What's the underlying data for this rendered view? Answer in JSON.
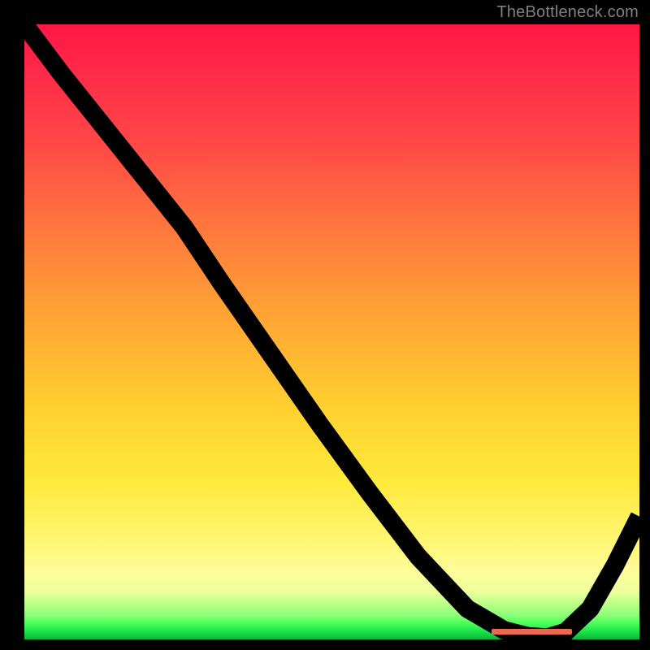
{
  "meta": {
    "watermark": "TheBottleneck.com"
  },
  "palette": {
    "top": "#ff1744",
    "mid": "#ffcf30",
    "bottom": "#0fb43a",
    "marker": "#e86a55",
    "curve": "#000000"
  },
  "chart_data": {
    "type": "line",
    "title": "",
    "xlabel": "",
    "ylabel": "",
    "xlim": [
      0,
      100
    ],
    "ylim": [
      0,
      100
    ],
    "annotations": [
      "TheBottleneck.com"
    ],
    "heat_background": {
      "direction": "vertical",
      "stops": [
        {
          "pos": 0,
          "color": "#ff1744"
        },
        {
          "pos": 34,
          "color": "#ff7a3d"
        },
        {
          "pos": 62,
          "color": "#ffcf30"
        },
        {
          "pos": 89,
          "color": "#fffc9a"
        },
        {
          "pos": 97.4,
          "color": "#4cff5a"
        },
        {
          "pos": 100,
          "color": "#0fb43a"
        }
      ]
    },
    "series": [
      {
        "name": "bottleneck_curve",
        "x": [
          0,
          6,
          12,
          18,
          22,
          26,
          32,
          40,
          48,
          56,
          64,
          72,
          78,
          82,
          85,
          88,
          92,
          96,
          100
        ],
        "y": [
          100,
          92,
          84.5,
          77,
          72,
          67,
          58,
          46.5,
          35,
          24,
          13.5,
          5,
          1.5,
          0.5,
          0.3,
          1.2,
          5,
          12,
          20
        ]
      }
    ],
    "marker": {
      "name": "optimal_range",
      "x_start": 76,
      "x_end": 89,
      "y": 1.3
    }
  }
}
